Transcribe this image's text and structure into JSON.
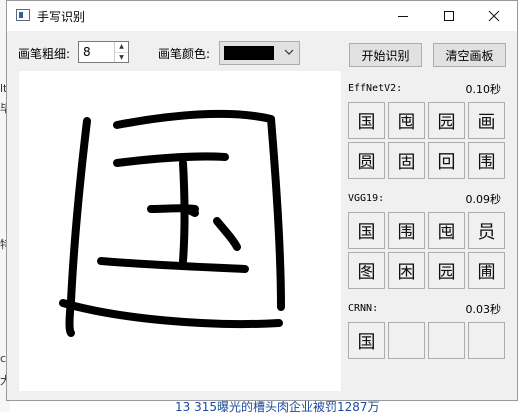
{
  "window": {
    "title": "手写识别"
  },
  "controls": {
    "pen_width_label": "画笔粗细:",
    "pen_width_value": "8",
    "pen_color_label": "画笔颜色:",
    "pen_color": "#000000",
    "recognize_button": "开始识别",
    "clear_button": "清空画板"
  },
  "results": {
    "effnet": {
      "label": "EffNetV2:",
      "time": "0.10秒",
      "chars": [
        "国",
        "囤",
        "园",
        "画",
        "圆",
        "固",
        "回",
        "围"
      ]
    },
    "vgg": {
      "label": "VGG19:",
      "time": "0.09秒",
      "chars": [
        "国",
        "围",
        "囤",
        "员",
        "图",
        "困",
        "园",
        "圃"
      ]
    },
    "crnn": {
      "label": "CRNN:",
      "time": "0.03秒",
      "chars": [
        "国",
        "",
        "",
        ""
      ]
    }
  },
  "background": {
    "bottom_text": "13 315曝光的槽头肉企业被罚1287万",
    "left_fragments": [
      "lt",
      "毕",
      "特",
      "c",
      "大"
    ]
  }
}
